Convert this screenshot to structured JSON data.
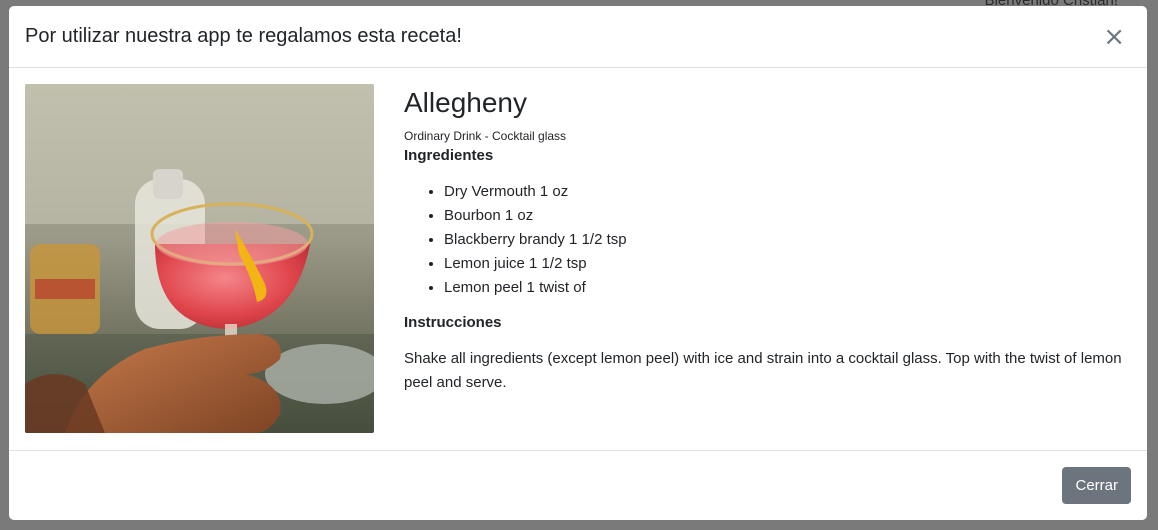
{
  "background": {
    "welcome_text": "Bienvenido Cristian!"
  },
  "modal": {
    "title": "Por utilizar nuestra app te regalamos esta receta!",
    "close_icon": "×",
    "footer_button_label": "Cerrar"
  },
  "recipe": {
    "name": "Allegheny",
    "meta": "Ordinary Drink - Cocktail glass",
    "ingredients_heading": "Ingredientes",
    "ingredients": [
      "Dry Vermouth 1 oz",
      "Bourbon 1 oz",
      "Blackberry brandy 1 1/2 tsp",
      "Lemon juice 1 1/2 tsp",
      "Lemon peel 1 twist of"
    ],
    "instructions_heading": "Instrucciones",
    "instructions": "Shake all ingredients (except lemon peel) with ice and strain into a cocktail glass. Top with the twist of lemon peel and serve."
  }
}
